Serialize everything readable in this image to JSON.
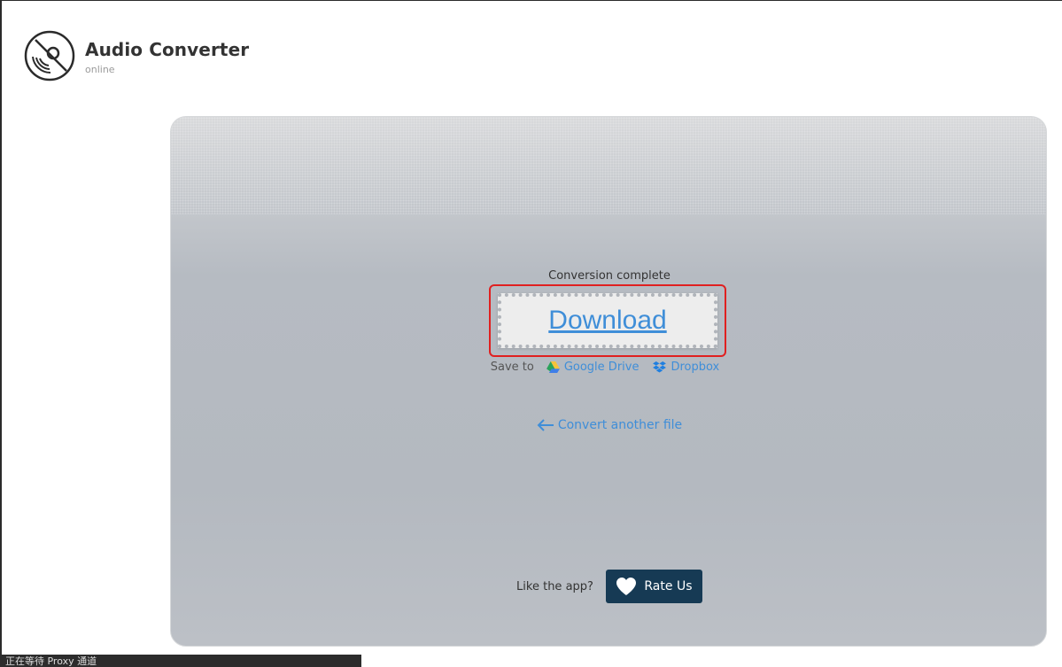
{
  "header": {
    "title": "Audio Converter",
    "subtitle": "online",
    "logo_icon": "disc-icon"
  },
  "result": {
    "status_text": "Conversion complete",
    "download_label": "Download",
    "save_to_label": "Save to",
    "save_options": [
      {
        "label": "Google Drive",
        "icon": "google-drive-icon"
      },
      {
        "label": "Dropbox",
        "icon": "dropbox-icon"
      }
    ],
    "convert_another_label": "Convert another file"
  },
  "rating": {
    "prompt": "Like the app?",
    "button_label": "Rate Us",
    "button_icon": "heart-icon"
  },
  "browser_status": {
    "text": "正在等待 Proxy 通道"
  },
  "colors": {
    "link": "#3f8ed8",
    "rate_button": "#163a54",
    "highlight": "#e02020"
  }
}
